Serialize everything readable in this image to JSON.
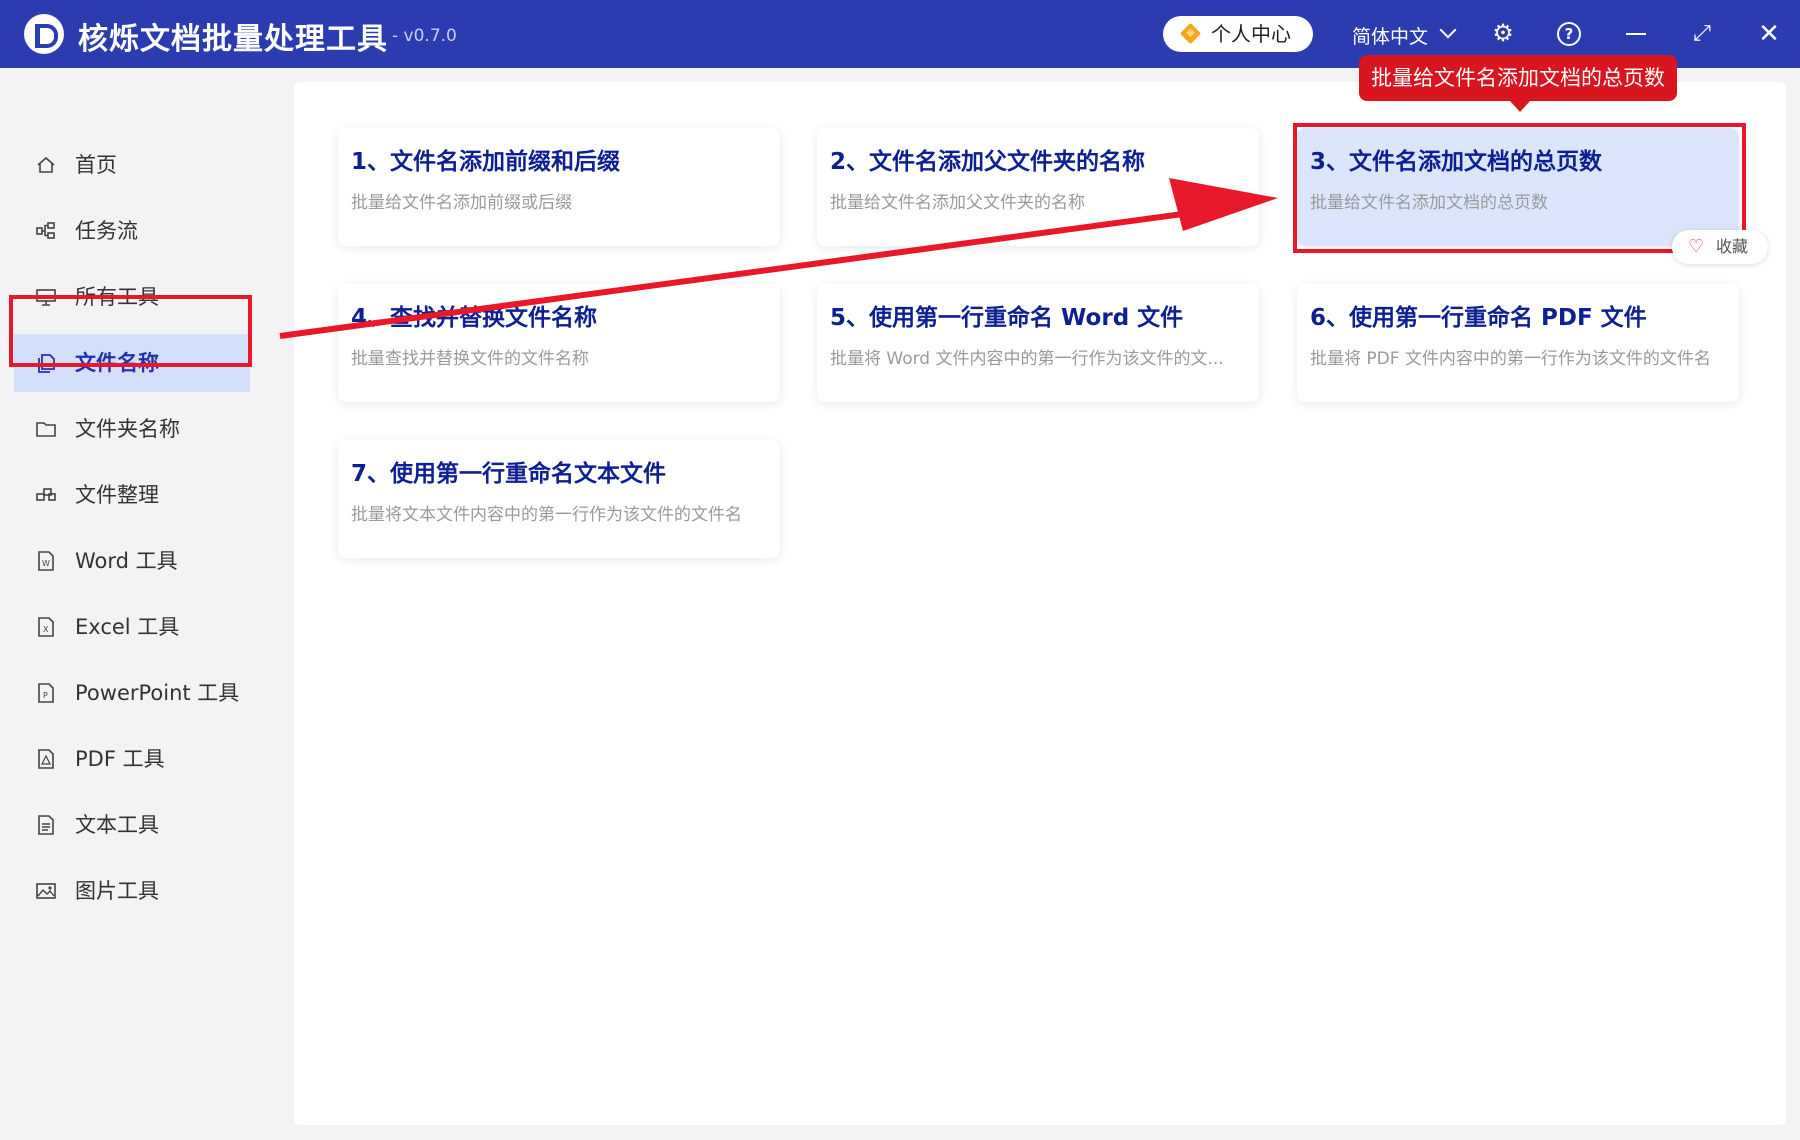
{
  "app": {
    "title": "核烁文档批量处理工具",
    "version": "- v0.7.0",
    "user_center_label": "个人中心",
    "language": "简体中文"
  },
  "sidebar": {
    "items": [
      {
        "label": "首页",
        "icon": "home-icon"
      },
      {
        "label": "任务流",
        "icon": "workflow-icon"
      },
      {
        "label": "所有工具",
        "icon": "monitor-icon"
      },
      {
        "label": "文件名称",
        "icon": "file-copy-icon",
        "active": true
      },
      {
        "label": "文件夹名称",
        "icon": "folder-icon"
      },
      {
        "label": "文件整理",
        "icon": "organize-icon"
      },
      {
        "label": "Word 工具",
        "icon": "word-file-icon"
      },
      {
        "label": "Excel 工具",
        "icon": "excel-file-icon"
      },
      {
        "label": "PowerPoint 工具",
        "icon": "ppt-file-icon"
      },
      {
        "label": "PDF 工具",
        "icon": "pdf-file-icon"
      },
      {
        "label": "文本工具",
        "icon": "text-file-icon"
      },
      {
        "label": "图片工具",
        "icon": "image-icon"
      }
    ]
  },
  "cards": [
    {
      "title": "1、文件名添加前缀和后缀",
      "desc": "批量给文件名添加前缀或后缀"
    },
    {
      "title": "2、文件名添加父文件夹的名称",
      "desc": "批量给文件名添加父文件夹的名称"
    },
    {
      "title": "3、文件名添加文档的总页数",
      "desc": "批量给文件名添加文档的总页数"
    },
    {
      "title": "4、查找并替换文件名称",
      "desc": "批量查找并替换文件的文件名称"
    },
    {
      "title": "5、使用第一行重命名 Word 文件",
      "desc": "批量将 Word 文件内容中的第一行作为该文件的文..."
    },
    {
      "title": "6、使用第一行重命名 PDF 文件",
      "desc": "批量将 PDF 文件内容中的第一行作为该文件的文件名"
    },
    {
      "title": "7、使用第一行重命名文本文件",
      "desc": "批量将文本文件内容中的第一行作为该文件的文件名"
    }
  ],
  "favorite_label": "收藏",
  "tooltip": "批量给文件名添加文档的总页数",
  "colors": {
    "titlebar": "#2b3bb0",
    "accent": "#0e1f92",
    "annotation": "#e8182a",
    "selected_card": "#dbe6fd"
  }
}
